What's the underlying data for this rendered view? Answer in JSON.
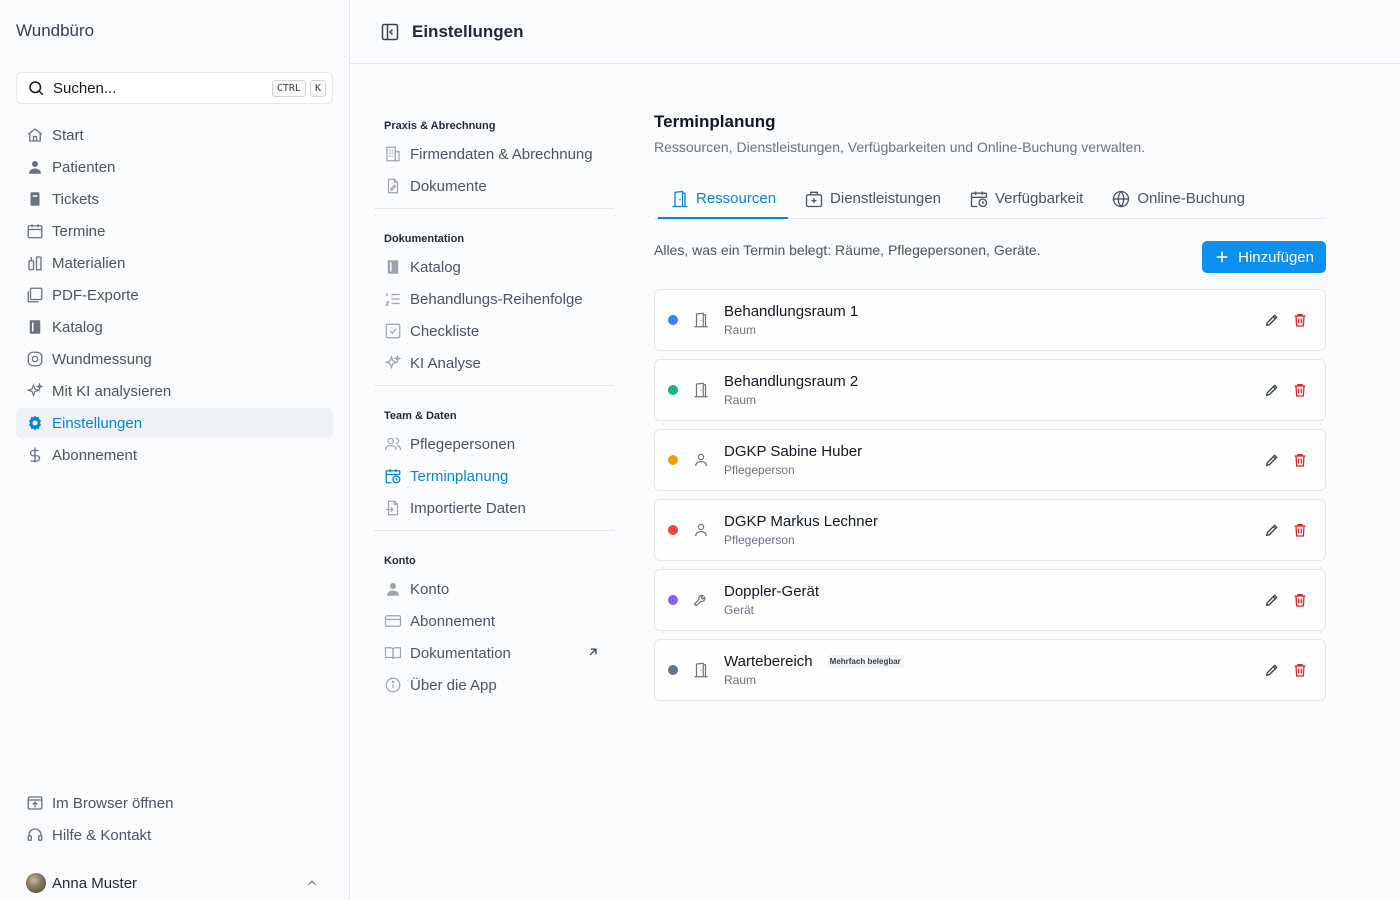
{
  "app": {
    "brand": "Wundbüro"
  },
  "search": {
    "placeholder": "Suchen...",
    "shortcut_key1": "CTRL",
    "shortcut_key2": "K"
  },
  "sidebar": {
    "items": [
      {
        "label": "Start",
        "icon": "home-icon"
      },
      {
        "label": "Patienten",
        "icon": "user-icon"
      },
      {
        "label": "Tickets",
        "icon": "ticket-icon"
      },
      {
        "label": "Termine",
        "icon": "calendar-icon"
      },
      {
        "label": "Materialien",
        "icon": "materials-icon"
      },
      {
        "label": "PDF-Exporte",
        "icon": "pdf-icon"
      },
      {
        "label": "Katalog",
        "icon": "book-icon"
      },
      {
        "label": "Wundmessung",
        "icon": "measure-icon"
      },
      {
        "label": "Mit KI analysieren",
        "icon": "sparkle-icon"
      },
      {
        "label": "Einstellungen",
        "icon": "gear-icon",
        "active": true
      },
      {
        "label": "Abonnement",
        "icon": "dollar-icon"
      }
    ],
    "bottom": [
      {
        "label": "Im Browser öffnen",
        "icon": "browser-icon"
      },
      {
        "label": "Hilfe & Kontakt",
        "icon": "headset-icon"
      }
    ],
    "user": {
      "name": "Anna Muster"
    }
  },
  "header": {
    "title": "Einstellungen"
  },
  "settings_nav": {
    "sections": [
      {
        "heading": "Praxis & Abrechnung",
        "items": [
          {
            "label": "Firmendaten & Abrechnung"
          },
          {
            "label": "Dokumente"
          }
        ]
      },
      {
        "heading": "Dokumentation",
        "items": [
          {
            "label": "Katalog"
          },
          {
            "label": "Behandlungs-Reihenfolge"
          },
          {
            "label": "Checkliste"
          },
          {
            "label": "KI Analyse"
          }
        ]
      },
      {
        "heading": "Team & Daten",
        "items": [
          {
            "label": "Pflegepersonen"
          },
          {
            "label": "Terminplanung",
            "active": true
          },
          {
            "label": "Importierte Daten"
          }
        ]
      },
      {
        "heading": "Konto",
        "items": [
          {
            "label": "Konto"
          },
          {
            "label": "Abonnement"
          },
          {
            "label": "Dokumentation"
          },
          {
            "label": "Über die App"
          }
        ]
      }
    ]
  },
  "page": {
    "title": "Terminplanung",
    "subtitle": "Ressourcen, Dienstleistungen, Verfügbarkeiten und Online-Buchung verwalten.",
    "tabs": [
      {
        "label": "Ressourcen",
        "active": true
      },
      {
        "label": "Dienstleistungen"
      },
      {
        "label": "Verfügbarkeit"
      },
      {
        "label": "Online-Buchung"
      }
    ],
    "description": "Alles, was ein Termin belegt: Räume, Pflegepersonen, Geräte.",
    "add_label": "Hinzufügen"
  },
  "resources": [
    {
      "name": "Behandlungsraum 1",
      "type": "Raum",
      "color": "#3b82f6",
      "icon": "door-icon"
    },
    {
      "name": "Behandlungsraum 2",
      "type": "Raum",
      "color": "#10b981",
      "icon": "door-icon"
    },
    {
      "name": "DGKP Sabine Huber",
      "type": "Pflegeperson",
      "color": "#f59e0b",
      "icon": "person-icon"
    },
    {
      "name": "DGKP Markus Lechner",
      "type": "Pflegeperson",
      "color": "#ef4444",
      "icon": "person-icon"
    },
    {
      "name": "Doppler-Gerät",
      "type": "Gerät",
      "color": "#8b5cf6",
      "icon": "wrench-icon"
    },
    {
      "name": "Wartebereich",
      "type": "Raum",
      "color": "#64748b",
      "icon": "door-icon",
      "badge": "Mehrfach belegbar"
    }
  ],
  "colors": {
    "accent": "#0b84d6",
    "button": "#0b8ff0",
    "delete": "#dc2626"
  }
}
